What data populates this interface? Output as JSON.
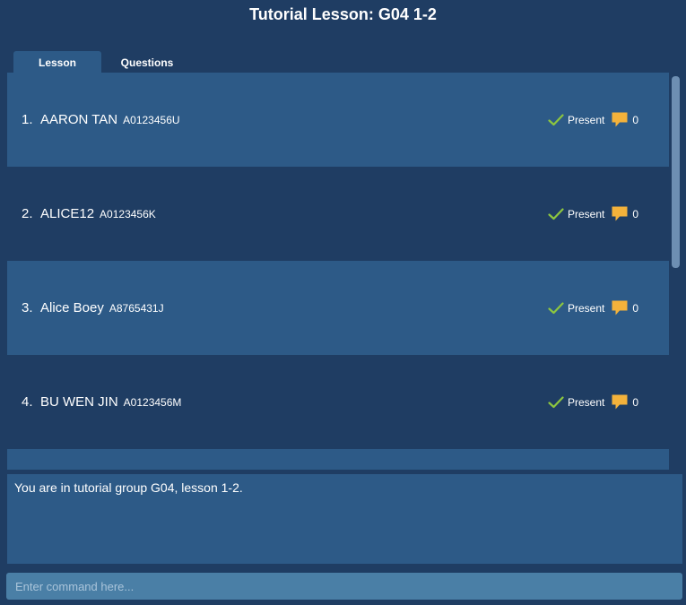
{
  "title": "Tutorial Lesson: G04 1-2",
  "tabs": [
    {
      "label": "Lesson",
      "active": true
    },
    {
      "label": "Questions",
      "active": false
    }
  ],
  "students": [
    {
      "index": "1.",
      "name": "AARON TAN",
      "id": "A0123456U",
      "status": "Present",
      "comments": "0"
    },
    {
      "index": "2.",
      "name": "ALICE12",
      "id": "A0123456K",
      "status": "Present",
      "comments": "0"
    },
    {
      "index": "3.",
      "name": "Alice Boey",
      "id": "A8765431J",
      "status": "Present",
      "comments": "0"
    },
    {
      "index": "4.",
      "name": "BU WEN JIN",
      "id": "A0123456M",
      "status": "Present",
      "comments": "0"
    }
  ],
  "result": {
    "text": "You are in tutorial group G04, lesson 1-2."
  },
  "command": {
    "placeholder": "Enter command here..."
  },
  "colors": {
    "background": "#1f3d63",
    "row_highlight": "#2d5a87",
    "check": "#8dc63f",
    "comment": "#f3b23b",
    "command_box": "#4a7fa6"
  },
  "icons": {
    "status": "check-icon",
    "comments": "comment-icon"
  }
}
